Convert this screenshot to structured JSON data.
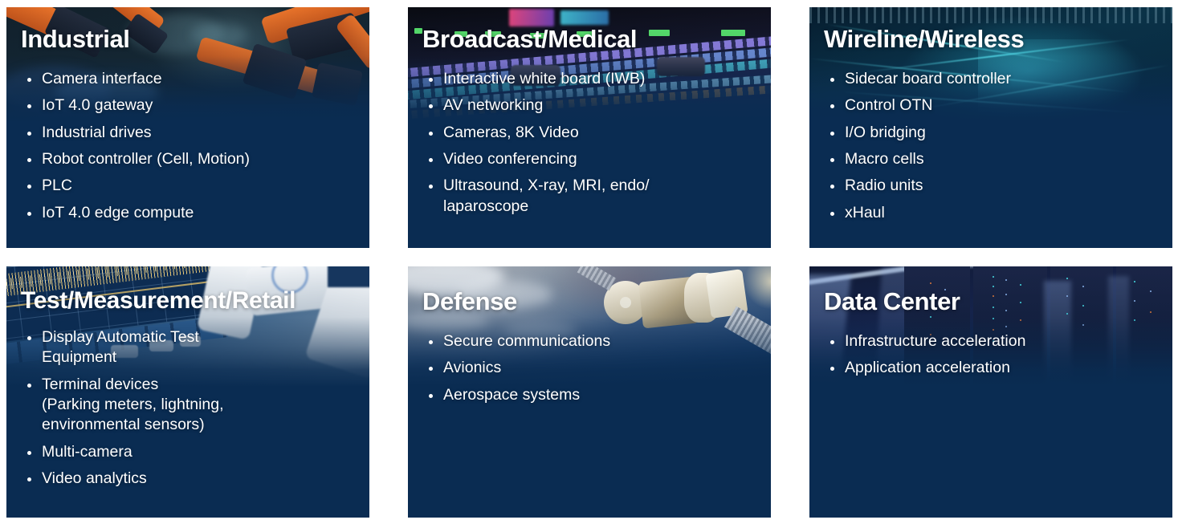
{
  "slide": {
    "layout": "three-by-two-card-grid",
    "card_background_color": "#0a2c52",
    "text_color": "#ffffff",
    "bullet_marker": "round-dot"
  },
  "cards": [
    {
      "id": "industrial",
      "title": "Industrial",
      "image": "industrial-robot-arms-photo",
      "bullets": [
        "Camera interface",
        "IoT 4.0 gateway",
        "Industrial drives",
        "Robot controller (Cell, Motion)",
        "PLC",
        "IoT 4.0 edge compute"
      ]
    },
    {
      "id": "broadcast-medical",
      "title": "Broadcast/Medical",
      "image": "broadcast-mixing-console-photo",
      "bullets": [
        "Interactive white board (IWB)",
        "AV networking",
        "Cameras, 8K Video",
        "Video conferencing",
        "Ultrasound, X-ray, MRI, endo/\nlaparoscope"
      ]
    },
    {
      "id": "wireline-wireless",
      "title": "Wireline/Wireless",
      "image": "network-cables-photo",
      "bullets": [
        "Sidecar board controller",
        "Control OTN",
        "I/O bridging",
        "Macro cells",
        "Radio units",
        "xHaul"
      ]
    },
    {
      "id": "test-measurement-retail",
      "title": "Test/Measurement/Retail",
      "image": "oscilloscope-test-equipment-photo",
      "bullets": [
        "Display Automatic Test\nEquipment",
        "Terminal devices\n(Parking meters, lightning,\nenvironmental sensors)",
        "Multi-camera",
        "Video analytics"
      ]
    },
    {
      "id": "defense",
      "title": "Defense",
      "image": "satellite-over-earth-photo",
      "bullets": [
        "Secure communications",
        "Avionics",
        "Aerospace systems"
      ]
    },
    {
      "id": "data-center",
      "title": "Data Center",
      "image": "server-racks-photo",
      "bullets": [
        "Infrastructure acceleration",
        "Application acceleration"
      ]
    }
  ]
}
